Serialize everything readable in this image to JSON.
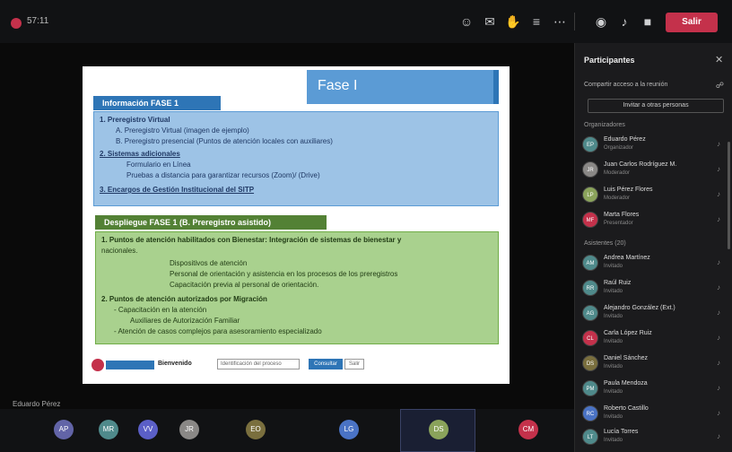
{
  "topbar": {
    "meeting_time": "57:11",
    "leave_label": "Salir",
    "icons": [
      "people-icon",
      "chat-icon",
      "raise-hand-icon",
      "more-icon",
      "ellipsis-icon",
      "camera-icon",
      "mic-icon",
      "share-icon"
    ]
  },
  "slide": {
    "title": "Fase I",
    "section1_header": "Información FASE 1",
    "section1_lines": [
      "1.  Preregistro Virtual",
      "A.  Preregistro Virtual (imagen de ejemplo)",
      "B.  Preregistro presencial (Puntos de atención locales con auxiliares)",
      "2.  Sistemas adicionales",
      "Formulario en Línea",
      "Pruebas a distancia para garantizar recursos (Zoom)/ (Drive)",
      "3.  Encargos de Gestión Institucional del SITP"
    ],
    "section2_header": "Despliegue FASE 1 (B. Preregistro asistido)",
    "section2_lines": [
      "1.  Puntos de atención habilitados con Bienestar: Integración de sistemas de bienestar y",
      "     nacionales.",
      "Dispositivos de atención",
      "Personal de orientación y asistencia en los procesos de los preregistros",
      "Capacitación previa al personal de orientación.",
      "2.  Puntos de atención autorizados por Migración",
      "-   Capacitación en la atención",
      "Auxiliares de Autorización Familiar",
      "-   Atención de casos complejos para asesoramiento especializado"
    ],
    "footer_text": "Bienvenido",
    "footer_input": "Identificación del proceso",
    "footer_btn": "Consultar",
    "footer_btn2": "Salir"
  },
  "stage": {
    "speaker": "Eduardo Pérez"
  },
  "bottom_tiles": [
    {
      "initials": "AP",
      "color": "#6264a7"
    },
    {
      "initials": "MR",
      "color": "#4f8a8b"
    },
    {
      "initials": "VV",
      "color": "#5b5fc7"
    },
    {
      "initials": "JR",
      "color": "#8a8886"
    },
    {
      "initials": "EO",
      "color": "#7a6f3e"
    },
    {
      "initials": "LG",
      "color": "#4a73c5"
    },
    {
      "initials": "DS",
      "color": "#8aa35b"
    },
    {
      "initials": "CM",
      "color": "#c4314b"
    }
  ],
  "panel": {
    "title": "Participantes",
    "share_text": "Compartir acceso a la reunión",
    "invite_label": "Invitar a otras personas",
    "organizer_group": "Organizadores",
    "attendee_group": "Asistentes (20)",
    "organizers": [
      {
        "initials": "EP",
        "name": "Eduardo Pérez",
        "role": "Organizador",
        "color": "#4f8a8b"
      },
      {
        "initials": "JR",
        "name": "Juan Carlos Rodríguez M.",
        "role": "Moderador",
        "color": "#8a8886"
      },
      {
        "initials": "LP",
        "name": "Luis Pérez Flores",
        "role": "Moderador",
        "color": "#8aa35b"
      },
      {
        "initials": "MF",
        "name": "Marta Flores",
        "role": "Presentador",
        "color": "#c4314b"
      }
    ],
    "attendees": [
      {
        "initials": "AM",
        "name": "Andrea Martínez",
        "role": "Invitado",
        "color": "#4f8a8b"
      },
      {
        "initials": "RR",
        "name": "Raúl Ruiz",
        "role": "Invitado",
        "color": "#4f8a8b"
      },
      {
        "initials": "AG",
        "name": "Alejandro González (Ext.)",
        "role": "Invitado",
        "color": "#4f8a8b"
      },
      {
        "initials": "CL",
        "name": "Carla López Ruiz",
        "role": "Invitado",
        "color": "#c4314b"
      },
      {
        "initials": "DS",
        "name": "Daniel Sánchez",
        "role": "Invitado",
        "color": "#7a6f3e"
      },
      {
        "initials": "PM",
        "name": "Paula Mendoza",
        "role": "Invitado",
        "color": "#4f8a8b"
      },
      {
        "initials": "RC",
        "name": "Roberto Castillo",
        "role": "Invitado",
        "color": "#4a73c5"
      },
      {
        "initials": "LT",
        "name": "Lucía Torres",
        "role": "Invitado",
        "color": "#4f8a8b"
      }
    ]
  }
}
